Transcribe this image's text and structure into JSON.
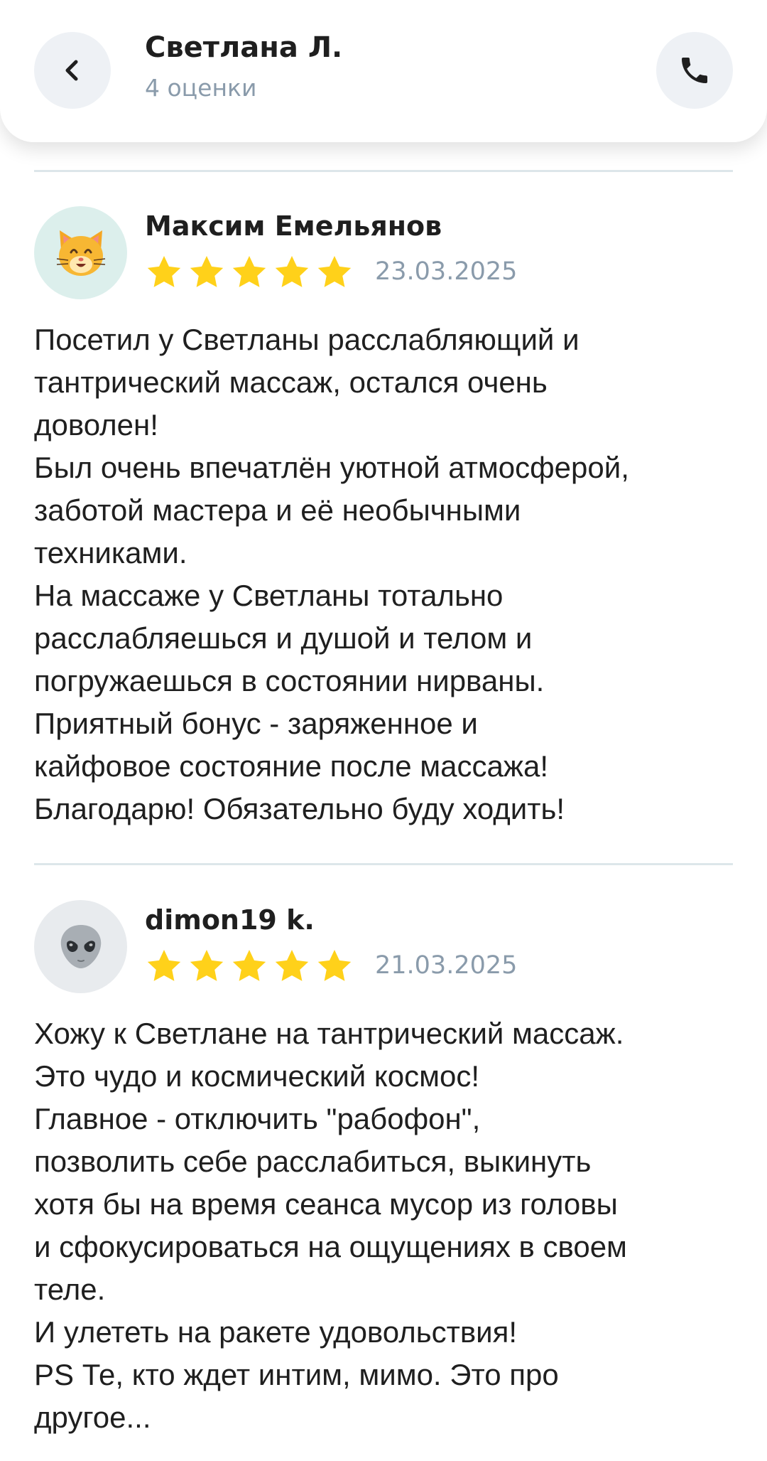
{
  "header": {
    "title": "Светлана Л.",
    "subtitle": "4 оценки"
  },
  "icons": {
    "back": "chevron-left-icon",
    "call": "phone-icon",
    "star_color": "#FFD11A"
  },
  "reviews": [
    {
      "author": "Максим Емельянов",
      "avatar": "cat-emoji",
      "rating": 5,
      "date": "23.03.2025",
      "text": "Посетил у Светланы расслабляющий и\nтантрический массаж, остался очень\nдоволен!\nБыл очень впечатлён уютной атмосферой,\nзаботой мастера и её необычными\nтехниками.\nНа массаже у Светланы тотально\nрасслабляешься и душой  и телом и\nпогружаешься в состоянии нирваны.\nПриятный бонус - заряженное и\nкайфовое состояние после массажа!\nБлагодарю! Обязательно буду ходить!"
    },
    {
      "author": "dimon19 k.",
      "avatar": "alien-emoji",
      "rating": 5,
      "date": "21.03.2025",
      "text": "Хожу к Светлане на тантрический массаж.\nЭто чудо и космический космос!\nГлавное - отключить \"рабофон\",\nпозволить себе расслабиться, выкинуть\nхотя бы на время сеанса мусор из головы\nи сфокусироваться на ощущениях в своем\nтеле.\nИ улететь на ракете удовольствия!\nPS Те, кто ждет интим, мимо. Это про\nдругое..."
    }
  ]
}
